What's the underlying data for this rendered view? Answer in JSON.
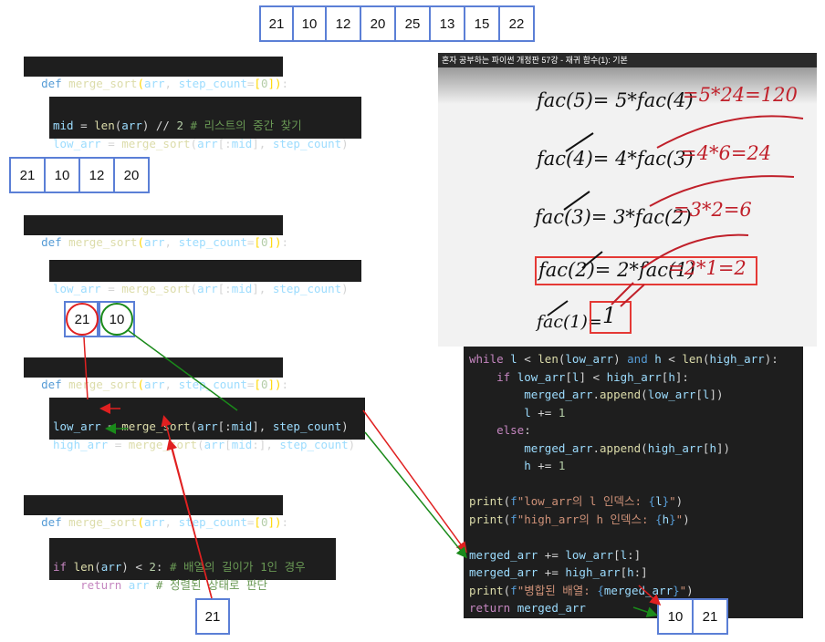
{
  "top_array": [
    "21",
    "10",
    "12",
    "20",
    "25",
    "13",
    "15",
    "22"
  ],
  "block1": {
    "def_line": "def merge_sort(arr, step_count=[0]):",
    "mid_line": "mid = len(arr) // 2 # 리스트의 중간 찾기",
    "low_line": "low_arr = merge_sort(arr[:mid], step_count)"
  },
  "second_array": [
    "21",
    "10",
    "12",
    "20"
  ],
  "block2": {
    "def_line": "def merge_sort(arr, step_count=[0]):",
    "low_line": "low_arr = merge_sort(arr[:mid], step_count)"
  },
  "pair": {
    "left": "21",
    "right": "10"
  },
  "block3": {
    "def_line": "def merge_sort(arr, step_count=[0]):",
    "low_line": "low_arr = merge_sort(arr[:mid], step_count)",
    "high_line": "high_arr = merge_sort(arr[mid:], step_count)"
  },
  "block4": {
    "def_line": "def merge_sort(arr, step_count=[0]):",
    "if_line": "if len(arr) < 2: # 배열의 길이가 1인 경우",
    "return_line": "return arr # 정렬된 상태로 판단"
  },
  "single": "21",
  "video": {
    "title": "혼자 공부하는 파이썬 개정판 57강 - 재귀 함수(1): 기본",
    "lines": [
      {
        "left": "fac(5)= 5*fac(4)",
        "right": "=5*24=120"
      },
      {
        "left": "fac(4)= 4*fac(3)",
        "right": "=4*6=24"
      },
      {
        "left": "fac(3)= 3*fac(2)",
        "right": "=3*2=6"
      },
      {
        "left": "fac(2)= 2*fac(1)",
        "right": "=2*1=2"
      },
      {
        "left": "fac(1)=",
        "right": "1"
      }
    ]
  },
  "merge_code": {
    "l1": "while l < len(low_arr) and h < len(high_arr):",
    "l2": "if low_arr[l] < high_arr[h]:",
    "l3": "merged_arr.append(low_arr[l])",
    "l4": "l += 1",
    "l5": "else:",
    "l6": "merged_arr.append(high_arr[h])",
    "l7": "h += 1",
    "l8": "print(f\"low_arr의 l 인덱스: {l}\")",
    "l9": "print(f\"high_arr의 h 인덱스: {h}\")",
    "l10": "merged_arr += low_arr[l:]",
    "l11": "merged_arr += high_arr[h:]",
    "l12": "print(f\"병합된 배열: {merged_arr}\")",
    "l13": "return merged_arr"
  },
  "result_array": [
    "10",
    "21"
  ],
  "colors": {
    "box_border": "#5b7fd6",
    "red_arrow": "#e02020",
    "green_arrow": "#1a8a1a",
    "highlight": "#e53935"
  }
}
